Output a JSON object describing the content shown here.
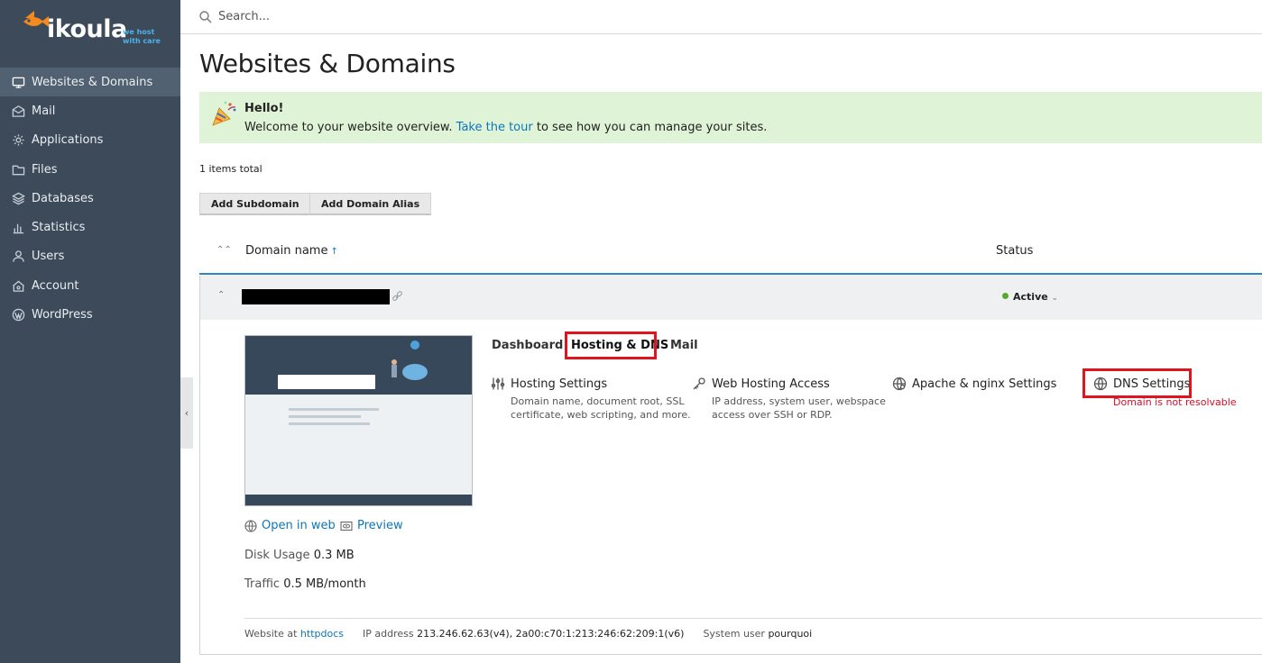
{
  "brand": {
    "name": "ikoula",
    "tagline_line1": "we host",
    "tagline_line2": "with care"
  },
  "search": {
    "placeholder": "Search..."
  },
  "sidebar": {
    "items": [
      {
        "label": "Websites & Domains",
        "icon": "monitor-icon",
        "active": true
      },
      {
        "label": "Mail",
        "icon": "mail-icon"
      },
      {
        "label": "Applications",
        "icon": "gear-icon"
      },
      {
        "label": "Files",
        "icon": "folder-icon"
      },
      {
        "label": "Databases",
        "icon": "database-icon"
      },
      {
        "label": "Statistics",
        "icon": "bar-chart-icon"
      },
      {
        "label": "Users",
        "icon": "user-icon"
      },
      {
        "label": "Account",
        "icon": "account-icon"
      },
      {
        "label": "WordPress",
        "icon": "wordpress-icon"
      }
    ]
  },
  "page": {
    "title": "Websites & Domains"
  },
  "hello": {
    "title": "Hello!",
    "text_before": "Welcome to your website overview.",
    "link": "Take the tour",
    "text_after": "to see how you can manage your sites."
  },
  "list": {
    "items_total": "1 items total",
    "add_subdomain": "Add Subdomain",
    "add_alias": "Add Domain Alias",
    "col_domain": "Domain name",
    "sort_indicator": "↑",
    "col_status": "Status"
  },
  "domain": {
    "status": "Active",
    "open_in_web": "Open in web",
    "preview": "Preview",
    "disk_label": "Disk Usage",
    "disk_value": "0.3 MB",
    "traffic_label": "Traffic",
    "traffic_value": "0.5 MB/month"
  },
  "tabs": [
    "Dashboard",
    "Hosting & DNS",
    "Mail"
  ],
  "features": {
    "hosting_settings": {
      "title": "Hosting Settings",
      "desc1": "Domain name, document root, SSL",
      "desc2": "certificate, web scripting, and more."
    },
    "web_hosting_access": {
      "title": "Web Hosting Access",
      "desc1": "IP address, system user, webspace",
      "desc2": "access over SSH or RDP."
    },
    "apache_nginx": {
      "title": "Apache & nginx Settings"
    },
    "dns_settings": {
      "title": "DNS Settings",
      "error": "Domain is not resolvable"
    }
  },
  "footer": {
    "website_at_label": "Website at",
    "website_at_value": "httpdocs",
    "ip_label": "IP address",
    "ip_value": "213.246.62.63(v4), 2a00:c70:1:213:246:62:209:1(v6)",
    "sysuser_label": "System user",
    "sysuser_value": "pourquoi"
  },
  "colors": {
    "sidebar_bg": "#3c4a5a",
    "accent_link": "#0e76ba",
    "highlight_red": "#e0141e",
    "status_green": "#5aa92d",
    "hello_bg": "#dff3d6"
  }
}
